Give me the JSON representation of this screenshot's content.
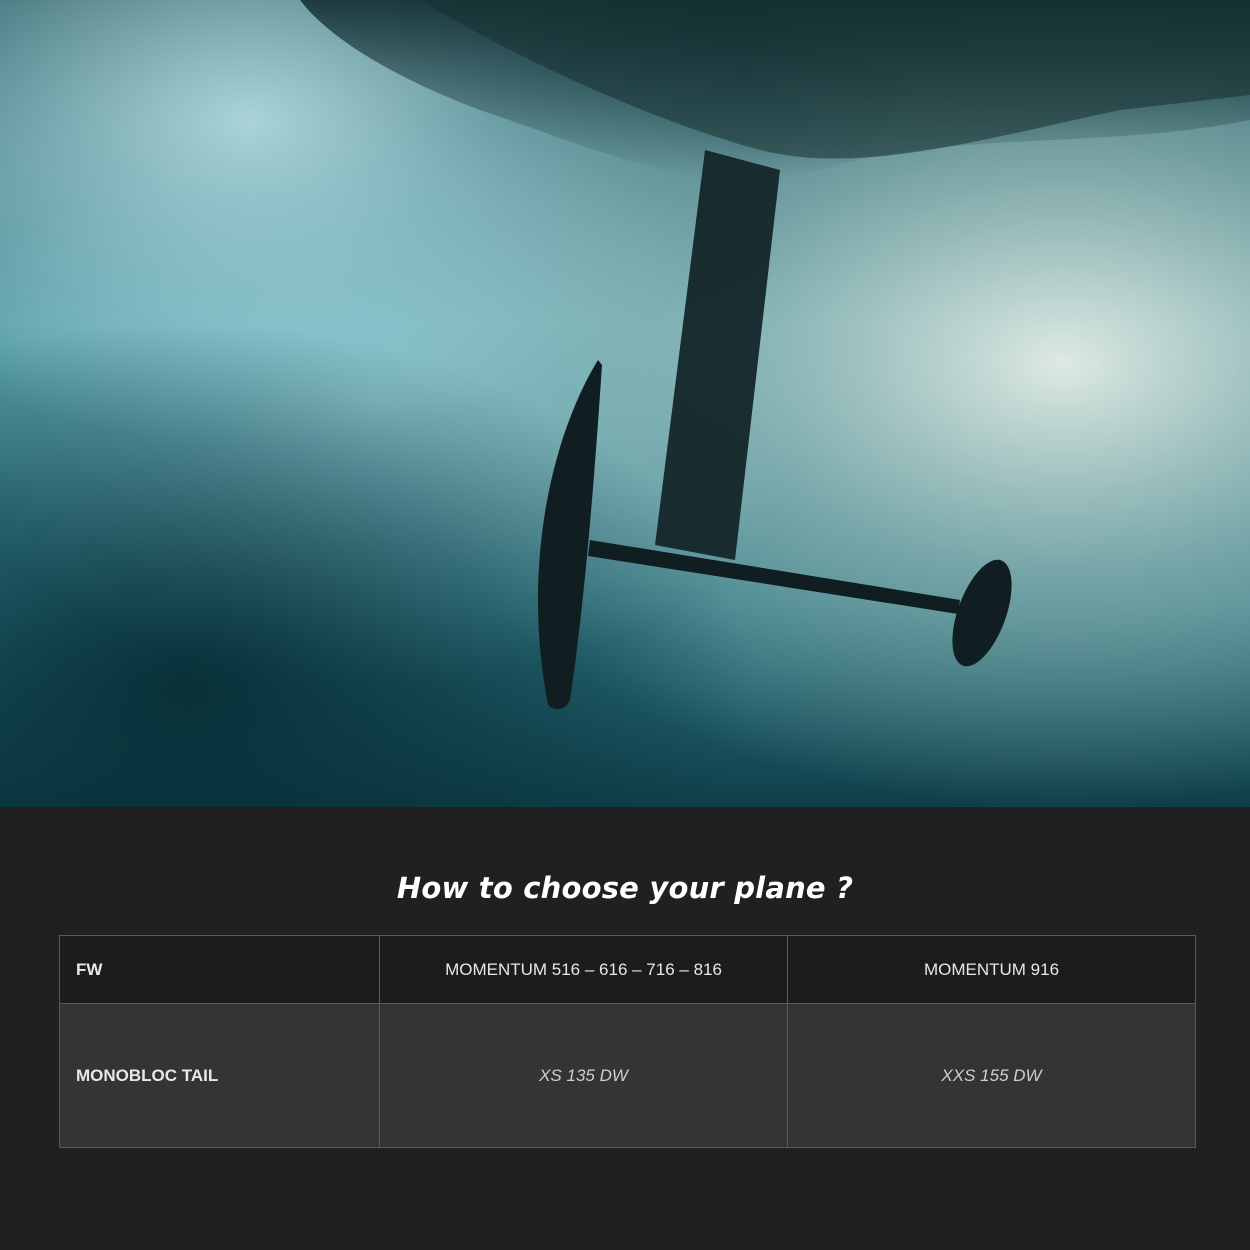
{
  "hero": {
    "image": "underwater-hydrofoil-photo"
  },
  "heading": "How to choose your plane ?",
  "table": {
    "header": {
      "label": "FW",
      "col1": "MOMENTUM 516 – 616 – 716 – 816",
      "col2": "MOMENTUM 916"
    },
    "rows": [
      {
        "label": "MONOBLOC TAIL",
        "col1": "XS 135 DW",
        "col2": "XXS 155 DW"
      }
    ]
  },
  "colors": {
    "background": "#202020",
    "header_row": "#1c1c1c",
    "body_row": "#343434",
    "border": "#5a5a5a",
    "text": "#ffffff"
  }
}
